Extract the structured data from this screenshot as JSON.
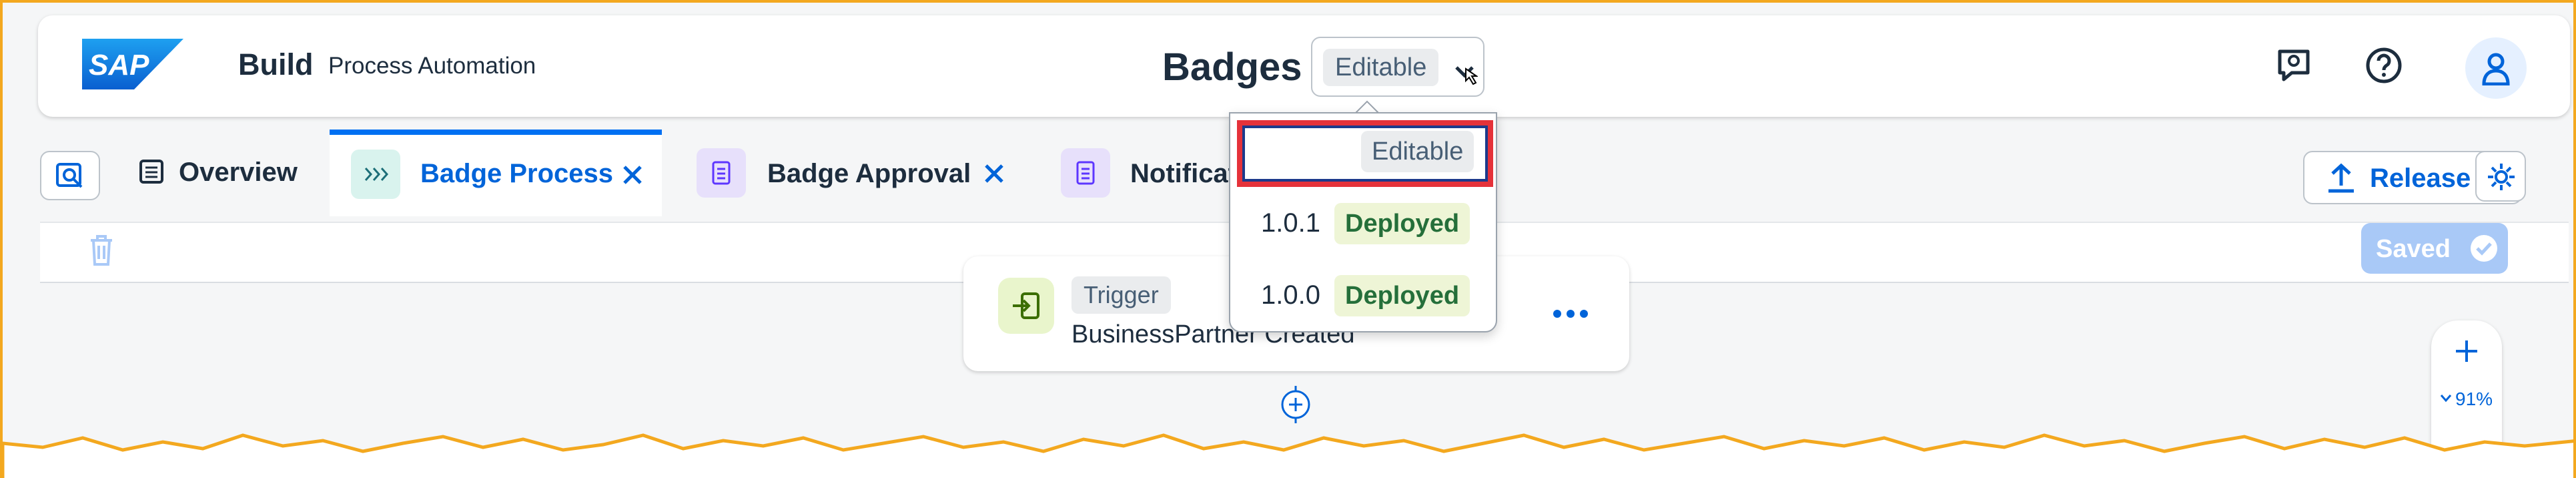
{
  "shell": {
    "brand": "Build",
    "product": "Process Automation",
    "title": "Badges",
    "version_label": "Editable"
  },
  "tabs": [
    {
      "label": "Overview",
      "icon": "list-icon"
    },
    {
      "label": "Badge Process",
      "icon": "process-icon",
      "active": true
    },
    {
      "label": "Badge Approval",
      "icon": "form-icon"
    },
    {
      "label": "Notificat",
      "icon": "form-icon"
    }
  ],
  "toolbar": {
    "release_label": "Release",
    "saved_label": "Saved"
  },
  "canvas": {
    "trigger_chip": "Trigger",
    "trigger_name": "BusinessPartner Created",
    "zoom": "91%"
  },
  "version_dropdown": {
    "items": [
      {
        "version": "",
        "status": "Editable"
      },
      {
        "version": "1.0.1",
        "status": "Deployed"
      },
      {
        "version": "1.0.0",
        "status": "Deployed"
      }
    ]
  },
  "colors": {
    "accent": "#0064d9",
    "highlight_border": "#e5323a",
    "frame": "#f3a81f"
  }
}
